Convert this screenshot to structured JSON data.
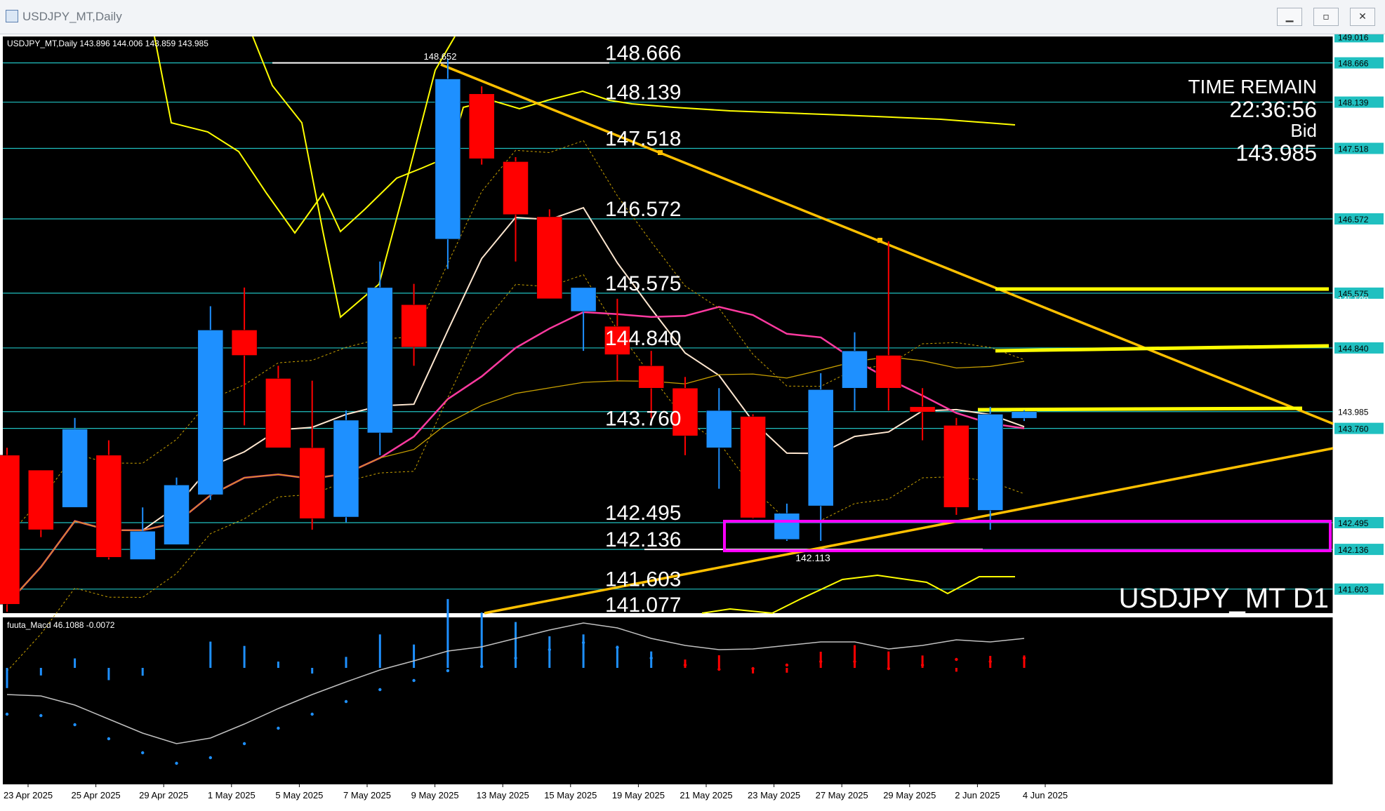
{
  "window": {
    "title": "USDJPY_MT,Daily",
    "min": "▁",
    "max": "▫",
    "close": "✕"
  },
  "header": {
    "info": "USDJPY_MT,Daily  143.896 144.006 143.859 143.985"
  },
  "panel": {
    "time_remain": "TIME REMAIN",
    "time_value": "22:36:56",
    "bid_label": "Bid",
    "bid_value": "143.985",
    "watermark": "USDJPY_MT D1"
  },
  "high_marker": "148.652",
  "low_marker": "142.113",
  "macd": {
    "label": "fuuta_Macd 46.1088  -0.0072",
    "scale_top": "50.297",
    "scale_bottom": "34.6817"
  },
  "colors": {
    "background": "#000000",
    "bull": "#1e90ff",
    "bear": "#ff0000",
    "level": "#20c0c0",
    "trend": "#ffc000",
    "ma_pink": "#ff3aa0",
    "ma_white": "#ffe7d0",
    "envelope": "#ffff00",
    "zone": "#ff00ff",
    "macd_line": "#c0c0c0"
  },
  "chart_data": {
    "type": "candlestick",
    "symbol": "USDJPY_MT",
    "timeframe": "Daily",
    "ylim": [
      141.28,
      149.02
    ],
    "yticks": [
      "149.016",
      "148.770",
      "148.666",
      "148.300",
      "148.139",
      "147.840",
      "147.518",
      "147.370",
      "146.900",
      "146.572",
      "146.440",
      "145.970",
      "145.575",
      "145.500",
      "144.840",
      "145.040",
      "144.570",
      "143.985",
      "144.100",
      "143.760",
      "143.640",
      "143.170",
      "142.700",
      "142.495",
      "142.240",
      "142.136",
      "141.770",
      "141.603",
      "141.300"
    ],
    "level_lines": [
      148.666,
      148.139,
      147.518,
      146.572,
      145.575,
      144.84,
      143.985,
      143.76,
      142.495,
      142.136,
      141.603
    ],
    "level_labels": [
      "148.666",
      "148.139",
      "147.518",
      "146.572",
      "145.575",
      "144.840",
      "143.760",
      "142.495",
      "142.136",
      "141.603",
      "141.077"
    ],
    "price_tags": [
      "149.016",
      "148.666",
      "148.139",
      "147.518",
      "146.572",
      "145.575",
      "144.840",
      "143.985",
      "143.760",
      "142.495",
      "142.136",
      "141.603"
    ],
    "xtick_labels": [
      "23 Apr 2025",
      "25 Apr 2025",
      "29 Apr 2025",
      "1 May 2025",
      "5 May 2025",
      "7 May 2025",
      "9 May 2025",
      "13 May 2025",
      "15 May 2025",
      "19 May 2025",
      "21 May 2025",
      "23 May 2025",
      "27 May 2025",
      "29 May 2025",
      "2 Jun 2025",
      "4 Jun 2025"
    ],
    "candles": [
      {
        "o": 143.4,
        "h": 143.5,
        "l": 141.3,
        "c": 141.4
      },
      {
        "o": 143.2,
        "h": 143.2,
        "l": 142.3,
        "c": 142.4
      },
      {
        "o": 142.7,
        "h": 143.9,
        "l": 142.7,
        "c": 143.75
      },
      {
        "o": 143.4,
        "h": 143.6,
        "l": 142.0,
        "c": 142.03
      },
      {
        "o": 142.0,
        "h": 142.7,
        "l": 142.0,
        "c": 142.38
      },
      {
        "o": 142.2,
        "h": 143.1,
        "l": 142.2,
        "c": 143.0
      },
      {
        "o": 142.87,
        "h": 145.4,
        "l": 142.8,
        "c": 145.08
      },
      {
        "o": 145.08,
        "h": 145.65,
        "l": 143.8,
        "c": 144.74
      },
      {
        "o": 144.43,
        "h": 144.6,
        "l": 143.6,
        "c": 143.5
      },
      {
        "o": 143.5,
        "h": 144.4,
        "l": 142.4,
        "c": 142.55
      },
      {
        "o": 142.57,
        "h": 144.0,
        "l": 142.5,
        "c": 143.87
      },
      {
        "o": 143.7,
        "h": 146.0,
        "l": 143.4,
        "c": 145.65
      },
      {
        "o": 145.42,
        "h": 145.7,
        "l": 144.6,
        "c": 144.85
      },
      {
        "o": 146.3,
        "h": 148.72,
        "l": 145.9,
        "c": 148.45
      },
      {
        "o": 148.25,
        "h": 148.35,
        "l": 147.3,
        "c": 147.38
      },
      {
        "o": 147.34,
        "h": 147.4,
        "l": 146.0,
        "c": 146.63
      },
      {
        "o": 146.6,
        "h": 146.7,
        "l": 145.5,
        "c": 145.5
      },
      {
        "o": 145.33,
        "h": 145.5,
        "l": 144.8,
        "c": 145.65
      },
      {
        "o": 145.13,
        "h": 145.5,
        "l": 144.4,
        "c": 144.75
      },
      {
        "o": 144.6,
        "h": 144.8,
        "l": 143.9,
        "c": 144.3
      },
      {
        "o": 144.3,
        "h": 144.45,
        "l": 143.4,
        "c": 143.66
      },
      {
        "o": 143.5,
        "h": 144.3,
        "l": 142.95,
        "c": 144.0
      },
      {
        "o": 143.92,
        "h": 143.95,
        "l": 142.55,
        "c": 142.56
      },
      {
        "o": 142.27,
        "h": 142.75,
        "l": 142.25,
        "c": 142.62
      },
      {
        "o": 142.72,
        "h": 144.5,
        "l": 142.25,
        "c": 144.28
      },
      {
        "o": 144.3,
        "h": 145.05,
        "l": 144.0,
        "c": 144.8
      },
      {
        "o": 144.74,
        "h": 146.27,
        "l": 144.0,
        "c": 144.3
      },
      {
        "o": 144.05,
        "h": 144.3,
        "l": 143.6,
        "c": 143.98
      },
      {
        "o": 143.8,
        "h": 143.9,
        "l": 142.6,
        "c": 142.7
      },
      {
        "o": 142.66,
        "h": 144.05,
        "l": 142.4,
        "c": 143.95
      },
      {
        "o": 143.896,
        "h": 144.006,
        "l": 143.859,
        "c": 143.985
      }
    ],
    "macd_hist": [
      3,
      6,
      0,
      0,
      0,
      0,
      0,
      0,
      0,
      0,
      0,
      0,
      0,
      0,
      0,
      0,
      0,
      0,
      0,
      0,
      0,
      0,
      0,
      0,
      0,
      0,
      0,
      0,
      0,
      0,
      0
    ]
  }
}
